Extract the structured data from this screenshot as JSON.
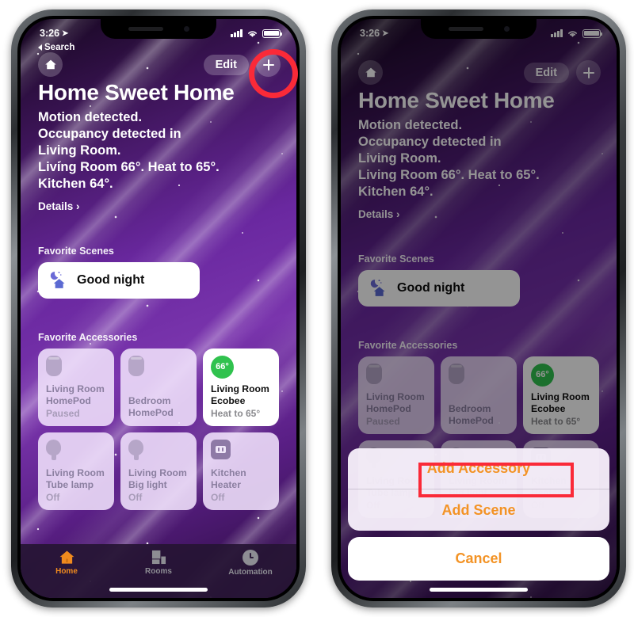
{
  "status_bar": {
    "time": "3:26",
    "location_icon": "location-arrow-icon",
    "cellular_icon": "cellular-bars-icon",
    "wifi_icon": "wifi-icon",
    "battery_icon": "battery-full-icon"
  },
  "back_link": {
    "label": "Search"
  },
  "nav": {
    "home_icon": "house-icon",
    "edit_label": "Edit",
    "add_icon": "plus-icon"
  },
  "header": {
    "title": "Home Sweet Home",
    "status_lines": [
      "Motion detected.",
      "Occupancy detected in",
      "Living Room.",
      "Living Room 66°. Heat to 65°.",
      "Kitchen 64°."
    ],
    "details_label": "Details ›"
  },
  "scenes": {
    "section_title": "Favorite Scenes",
    "items": [
      {
        "label": "Good night",
        "icon": "moon-house-icon"
      }
    ]
  },
  "accessories": {
    "section_title": "Favorite Accessories",
    "items": [
      {
        "name": "Living Room\nHomePod",
        "name_line1": "Living Room",
        "name_line2": "HomePod",
        "state": "Paused",
        "icon": "homepod-icon",
        "active": false
      },
      {
        "name_line1": "Bedroom",
        "name_line2": "HomePod",
        "state": "",
        "icon": "homepod-icon",
        "active": false
      },
      {
        "name_line1": "Living Room",
        "name_line2": "Ecobee",
        "state": "Heat to 65°",
        "icon": "thermostat-badge",
        "badge": "66°",
        "active": true
      },
      {
        "name_line1": "Living Room",
        "name_line2": "Tube lamp",
        "state": "Off",
        "icon": "bulb-icon",
        "active": false
      },
      {
        "name_line1": "Living Room",
        "name_line2": "Big light",
        "state": "Off",
        "icon": "bulb-icon",
        "active": false
      },
      {
        "name_line1": "Kitchen",
        "name_line2": "Heater",
        "state": "Off",
        "icon": "outlet-icon",
        "active": false
      }
    ]
  },
  "tab_bar": {
    "tabs": [
      {
        "label": "Home",
        "icon": "house-filled-icon",
        "active": true
      },
      {
        "label": "Rooms",
        "icon": "rooms-grid-icon",
        "active": false
      },
      {
        "label": "Automation",
        "icon": "clock-icon",
        "active": false
      }
    ]
  },
  "action_sheet": {
    "items": [
      {
        "label": "Add Accessory",
        "highlighted": true
      },
      {
        "label": "Add Scene",
        "highlighted": false
      }
    ],
    "cancel_label": "Cancel"
  },
  "colors": {
    "accent_orange": "#f39325",
    "annotation_red": "#fa2a38",
    "thermostat_green": "#30c24e",
    "tab_active": "#f08a1e"
  }
}
